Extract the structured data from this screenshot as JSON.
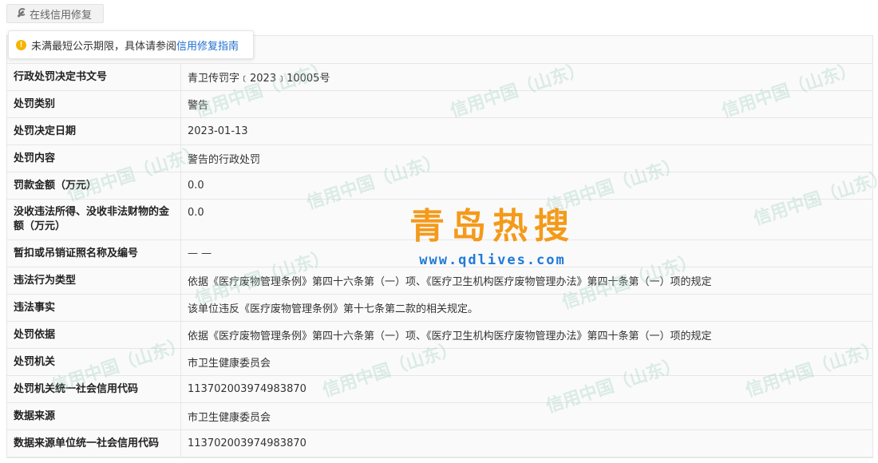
{
  "repair_tab": {
    "label": "在线信用修复"
  },
  "notice": {
    "text": "未满最短公示期限，具体请参阅",
    "link": "信用修复指南"
  },
  "watermark": {
    "text": "信用中国（山东）"
  },
  "logo": {
    "name": "青岛热搜",
    "url": "www.qdlives.com"
  },
  "rows": [
    {
      "label": "行政处罚决定书文号",
      "value": "青卫传罚字﹝2023﹞10005号"
    },
    {
      "label": "处罚类别",
      "value": "警告"
    },
    {
      "label": "处罚决定日期",
      "value": "2023-01-13"
    },
    {
      "label": "处罚内容",
      "value": "警告的行政处罚"
    },
    {
      "label": "罚款金额（万元）",
      "value": "0.0"
    },
    {
      "label": "没收违法所得、没收非法财物的金额（万元）",
      "value": "0.0"
    },
    {
      "label": "暂扣或吊销证照名称及编号",
      "value": "— —"
    },
    {
      "label": "违法行为类型",
      "value": "依据《医疗废物管理条例》第四十六条第（一）项、《医疗卫生机构医疗废物管理办法》第四十条第（一）项的规定"
    },
    {
      "label": "违法事实",
      "value": "该单位违反《医疗废物管理条例》第十七条第二款的相关规定。"
    },
    {
      "label": "处罚依据",
      "value": "依据《医疗废物管理条例》第四十六条第（一）项、《医疗卫生机构医疗废物管理办法》第四十条第（一）项的规定"
    },
    {
      "label": "处罚机关",
      "value": "市卫生健康委员会"
    },
    {
      "label": "处罚机关统一社会信用代码",
      "value": "113702003974983870"
    },
    {
      "label": "数据来源",
      "value": "市卫生健康委员会"
    },
    {
      "label": "数据来源单位统一社会信用代码",
      "value": "113702003974983870"
    }
  ]
}
